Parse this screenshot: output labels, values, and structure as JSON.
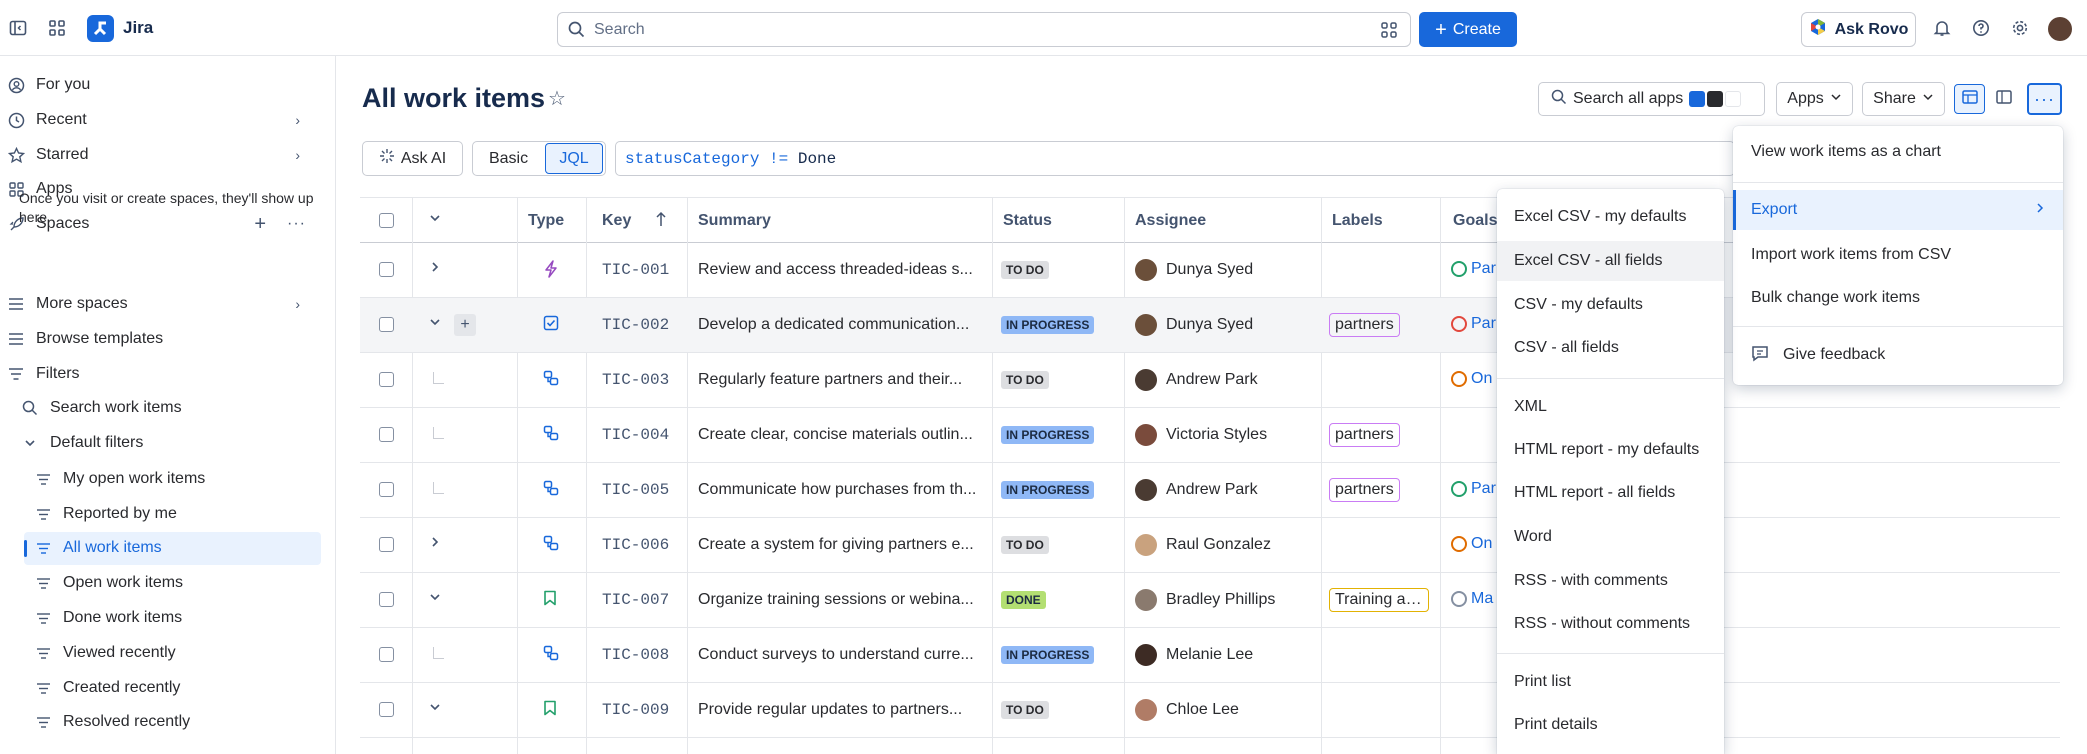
{
  "app": {
    "name": "Jira"
  },
  "topbar": {
    "search_placeholder": "Search",
    "create_label": "Create",
    "ask_rovo_label": "Ask Rovo"
  },
  "sidebar": {
    "for_you": "For you",
    "recent": "Recent",
    "starred": "Starred",
    "apps": "Apps",
    "spaces": "Spaces",
    "spaces_note": "Once you visit or create spaces, they'll show up here.",
    "more_spaces": "More spaces",
    "browse_templates": "Browse templates",
    "filters": "Filters",
    "search_work_items": "Search work items",
    "default_filters": "Default filters",
    "filter_items": [
      "My open work items",
      "Reported by me",
      "All work items",
      "Open work items",
      "Done work items",
      "Viewed recently",
      "Created recently",
      "Resolved recently"
    ]
  },
  "page": {
    "title": "All work items",
    "search_all_apps": "Search all apps",
    "apps_label": "Apps",
    "share_label": "Share",
    "ask_ai": "Ask AI",
    "basic": "Basic",
    "jql": "JQL",
    "jql_field": "statusCategory",
    "jql_op": "!=",
    "jql_value": "Done"
  },
  "table": {
    "columns": {
      "type": "Type",
      "key": "Key",
      "summary": "Summary",
      "status": "Status",
      "assignee": "Assignee",
      "labels": "Labels",
      "goals": "Goals"
    },
    "rows": [
      {
        "key": "TIC-001",
        "summary": "Review and access threaded-ideas s...",
        "status": "TO DO",
        "assignee": "Dunya Syed",
        "label": "",
        "goal": "Par",
        "type": "epic",
        "exp": "right",
        "status_color": "#dddee1",
        "status_text_color": "#292a2e",
        "av": "#6b4f3a",
        "goal_color": "#22a06b"
      },
      {
        "key": "TIC-002",
        "summary": "Develop a dedicated communication...",
        "status": "IN PROGRESS",
        "assignee": "Dunya Syed",
        "label": "partners",
        "goal": "Par",
        "type": "task",
        "exp": "down",
        "status_color": "#8fb8f6",
        "status_text_color": "#1c2b42",
        "av": "#6b4f3a",
        "goal_color": "#e2483d"
      },
      {
        "key": "TIC-003",
        "summary": "Regularly feature partners and their...",
        "status": "TO DO",
        "assignee": "Andrew Park",
        "label": "",
        "goal": "On",
        "type": "subtask",
        "exp": "child",
        "status_color": "#dddee1",
        "status_text_color": "#292a2e",
        "av": "#4a3b32",
        "goal_color": "#e06c00"
      },
      {
        "key": "TIC-004",
        "summary": "Create clear, concise materials outlin...",
        "status": "IN PROGRESS",
        "assignee": "Victoria Styles",
        "label": "partners",
        "goal": "",
        "type": "subtask",
        "exp": "child",
        "status_color": "#8fb8f6",
        "status_text_color": "#1c2b42",
        "av": "#7a4b3c",
        "goal_color": "#22a06b"
      },
      {
        "key": "TIC-005",
        "summary": "Communicate how purchases from th...",
        "status": "IN PROGRESS",
        "assignee": "Andrew Park",
        "label": "partners",
        "goal": "Par",
        "type": "subtask",
        "exp": "child",
        "status_color": "#8fb8f6",
        "status_text_color": "#1c2b42",
        "av": "#4a3b32",
        "goal_color": "#22a06b"
      },
      {
        "key": "TIC-006",
        "summary": "Create a system for giving partners e...",
        "status": "TO DO",
        "assignee": "Raul Gonzalez",
        "label": "",
        "goal": "On",
        "type": "subtask",
        "exp": "right",
        "status_color": "#dddee1",
        "status_text_color": "#292a2e",
        "av": "#c9a27e",
        "goal_color": "#e06c00"
      },
      {
        "key": "TIC-007",
        "summary": "Organize training sessions or webina...",
        "status": "DONE",
        "assignee": "Bradley Phillips",
        "label": "Training an...",
        "goal": "Ma",
        "type": "story",
        "exp": "down",
        "status_color": "#b3df72",
        "status_text_color": "#1c2b42",
        "av": "#8a7a6e",
        "goal_color": "#8590a2"
      },
      {
        "key": "TIC-008",
        "summary": "Conduct surveys to understand curre...",
        "status": "IN PROGRESS",
        "assignee": "Melanie Lee",
        "label": "",
        "goal": "",
        "type": "subtask",
        "exp": "child",
        "status_color": "#8fb8f6",
        "status_text_color": "#1c2b42",
        "av": "#3d2b24",
        "goal_color": "#22a06b"
      },
      {
        "key": "TIC-009",
        "summary": "Provide regular updates to partners...",
        "status": "TO DO",
        "assignee": "Chloe Lee",
        "label": "",
        "goal": "",
        "type": "story",
        "exp": "down",
        "status_color": "#dddee1",
        "status_text_color": "#292a2e",
        "av": "#b07c66",
        "goal_color": "#22a06b"
      }
    ]
  },
  "more_menu": {
    "items": [
      "View work items as a chart",
      "Export",
      "Import work items from CSV",
      "Bulk change work items",
      "Give feedback"
    ]
  },
  "export_menu": {
    "items": [
      "Excel CSV - my defaults",
      "Excel CSV - all fields",
      "CSV - my defaults",
      "CSV - all fields",
      "XML",
      "HTML report - my defaults",
      "HTML report - all fields",
      "Word",
      "RSS - with comments",
      "RSS - without comments",
      "Print list",
      "Print details"
    ]
  },
  "colors": {
    "brand": "#1868db",
    "selected_bg": "#e9f2fe",
    "label_border": "#c97cf4"
  }
}
